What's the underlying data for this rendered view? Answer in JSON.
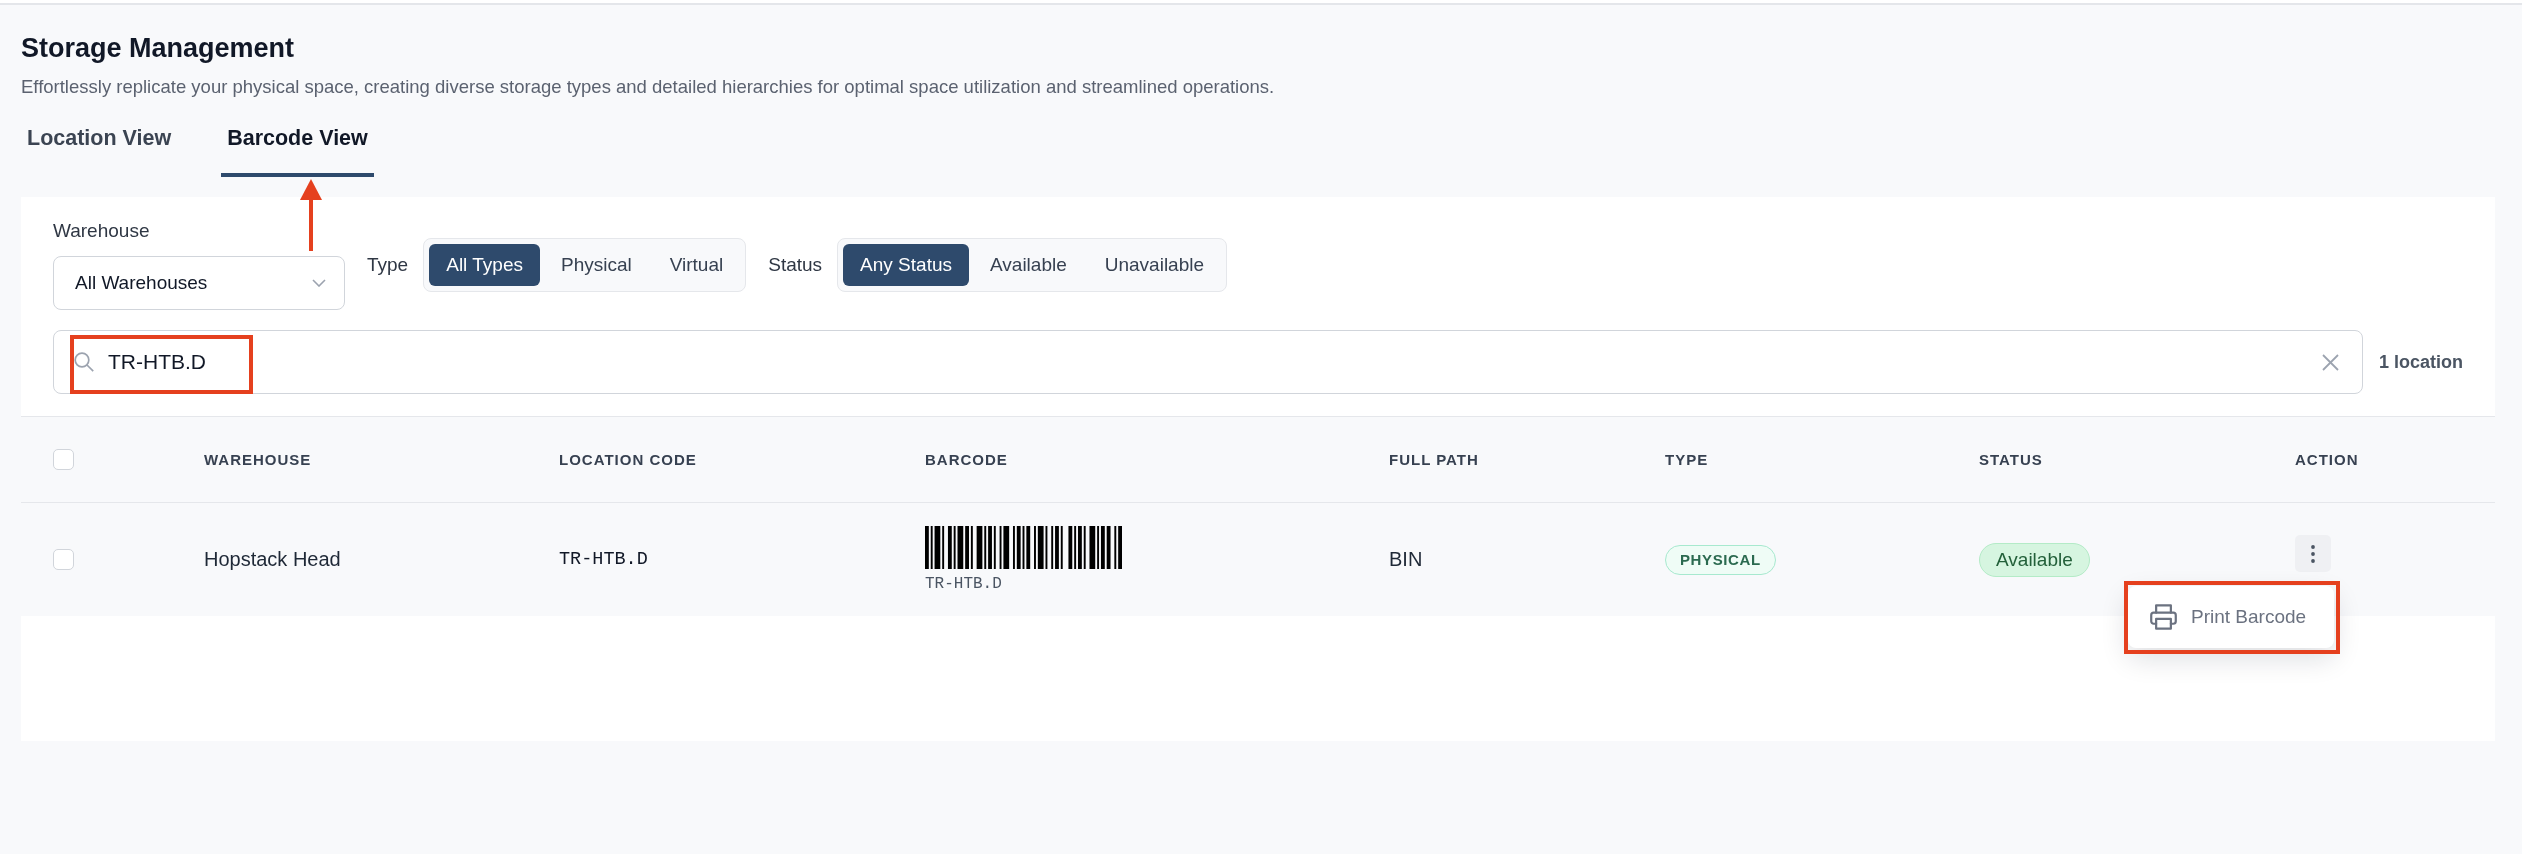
{
  "header": {
    "title": "Storage Management",
    "subtitle": "Effortlessly replicate your physical space, creating diverse storage types and detailed hierarchies for optimal space utilization and streamlined operations."
  },
  "tabs": [
    {
      "label": "Location View",
      "selected": false
    },
    {
      "label": "Barcode View",
      "selected": true
    }
  ],
  "filters": {
    "warehouse": {
      "label": "Warehouse",
      "value": "All Warehouses"
    },
    "type": {
      "label": "Type",
      "options": [
        {
          "label": "All Types",
          "selected": true
        },
        {
          "label": "Physical",
          "selected": false
        },
        {
          "label": "Virtual",
          "selected": false
        }
      ]
    },
    "status": {
      "label": "Status",
      "options": [
        {
          "label": "Any Status",
          "selected": true
        },
        {
          "label": "Available",
          "selected": false
        },
        {
          "label": "Unavailable",
          "selected": false
        }
      ]
    }
  },
  "search": {
    "value": "TR-HTB.D",
    "result_count": "1 location"
  },
  "table": {
    "header_checkbox": {
      "checked": false
    },
    "columns": [
      "WAREHOUSE",
      "LOCATION CODE",
      "BARCODE",
      "FULL PATH",
      "TYPE",
      "STATUS",
      "ACTION"
    ],
    "rows": [
      {
        "checked": false,
        "warehouse": "Hopstack Head",
        "location_code": "TR-HTB.D",
        "barcode_text": "TR-HTB.D",
        "full_path": "BIN",
        "type": "PHYSICAL",
        "status": "Available",
        "action_menu": {
          "open": true,
          "items": [
            {
              "label": "Print Barcode"
            }
          ]
        }
      }
    ]
  },
  "annotations": {
    "arrow_to_selected_tab": true,
    "search_value_box": true,
    "menu_box": true
  }
}
